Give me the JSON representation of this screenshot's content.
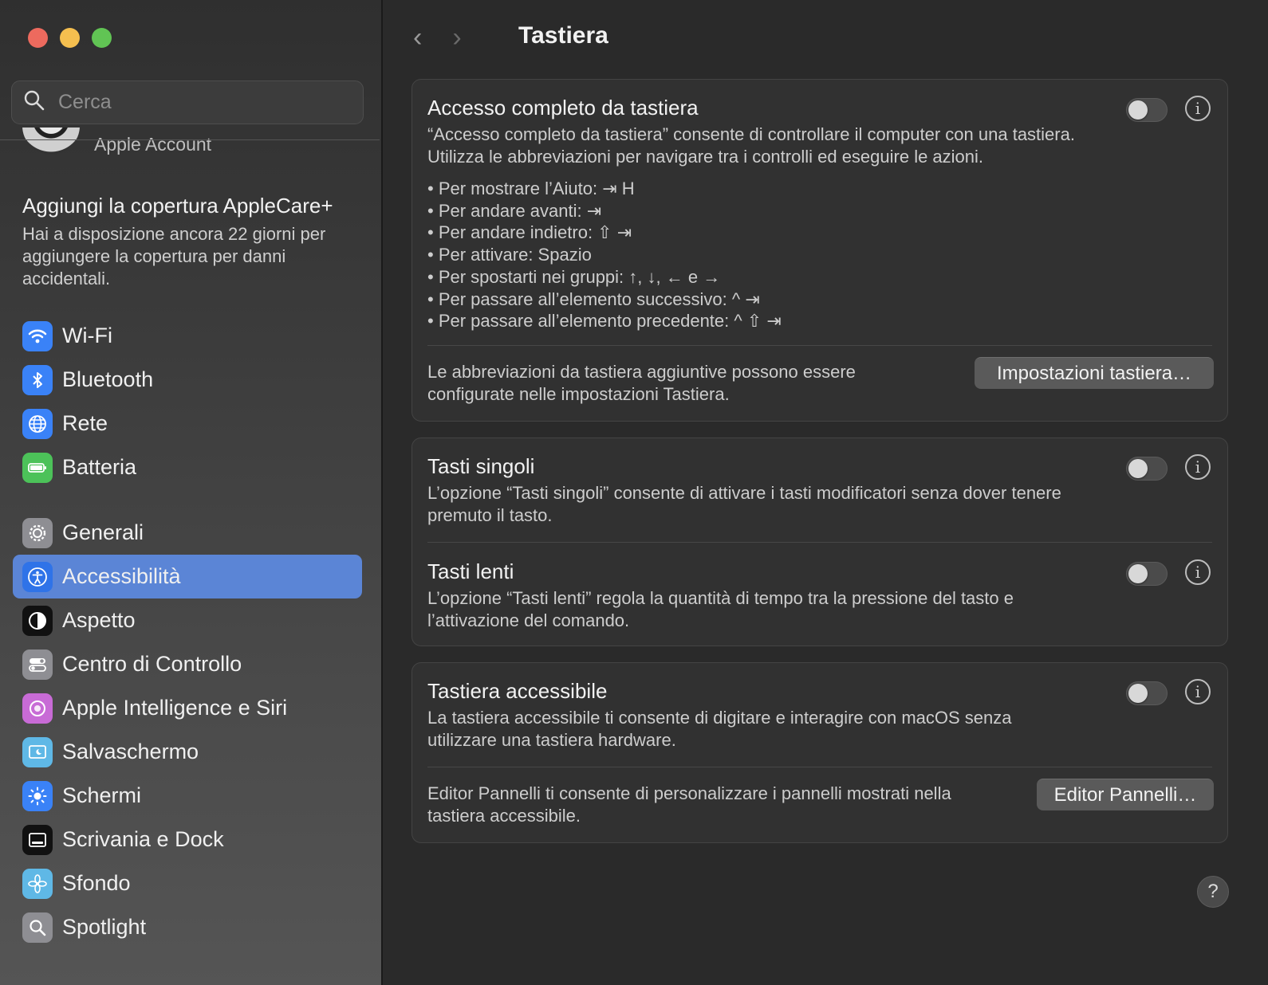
{
  "sidebar": {
    "search": {
      "placeholder": "Cerca"
    },
    "account": {
      "label": "Apple Account"
    },
    "applecare": {
      "title": "Aggiungi la copertura AppleCare+",
      "text": "Hai a disposizione ancora 22 giorni per aggiungere la copertura per danni accidentali."
    },
    "group1": [
      {
        "label": "Wi-Fi",
        "icon": "wifi-icon",
        "color": "#3a82f7"
      },
      {
        "label": "Bluetooth",
        "icon": "bluetooth-icon",
        "color": "#3a82f7"
      },
      {
        "label": "Rete",
        "icon": "globe-icon",
        "color": "#3a82f7"
      },
      {
        "label": "Batteria",
        "icon": "battery-icon",
        "color": "#4cc259"
      }
    ],
    "group2": [
      {
        "label": "Generali",
        "icon": "gear-icon",
        "color": "#8e8e93"
      },
      {
        "label": "Accessibilità",
        "icon": "accessibility-icon",
        "color": "#2f73e8"
      },
      {
        "label": "Aspetto",
        "icon": "appearance-icon",
        "color": "#111111"
      },
      {
        "label": "Centro di Controllo",
        "icon": "control-center-icon",
        "color": "#8e8e93"
      },
      {
        "label": "Apple Intelligence e Siri",
        "icon": "siri-icon",
        "color": "#c86bd6"
      },
      {
        "label": "Salvaschermo",
        "icon": "screensaver-icon",
        "color": "#5fb8e6"
      },
      {
        "label": "Schermi",
        "icon": "sun-icon",
        "color": "#3a82f7"
      },
      {
        "label": "Scrivania e Dock",
        "icon": "dock-icon",
        "color": "#111111"
      },
      {
        "label": "Sfondo",
        "icon": "flower-icon",
        "color": "#5fb8e6"
      },
      {
        "label": "Spotlight",
        "icon": "magnifier-icon",
        "color": "#8e8e93"
      }
    ],
    "active_label": "Accessibilità"
  },
  "main": {
    "title": "Tastiera",
    "full_keyboard": {
      "title": "Accesso completo da tastiera",
      "desc": "“Accesso completo da tastiera” consente di controllare il computer con una tastiera. Utilizza le abbreviazioni per navigare tra i controlli ed eseguire le azioni.",
      "bullets": [
        "Per mostrare l’Aiuto: ⇥ H",
        "Per andare avanti: ⇥",
        "Per andare indietro: ⇧ ⇥",
        "Per attivare: Spazio",
        "Per spostarti nei gruppi: ↑, ↓, ← e →",
        "Per passare all’elemento successivo: ^ ⇥",
        "Per passare all’elemento precedente: ^ ⇧ ⇥"
      ],
      "footer_text": "Le abbreviazioni da tastiera aggiuntive possono essere configurate nelle impostazioni Tastiera.",
      "button": "Impostazioni tastiera…",
      "enabled": false
    },
    "sticky_keys": {
      "title": "Tasti singoli",
      "desc": "L’opzione “Tasti singoli” consente di attivare i tasti modificatori senza dover tenere premuto il tasto.",
      "enabled": false
    },
    "slow_keys": {
      "title": "Tasti lenti",
      "desc": "L’opzione “Tasti lenti” regola la quantità di tempo tra la pressione del tasto e l’attivazione del comando.",
      "enabled": false
    },
    "accessible_keyboard": {
      "title": "Tastiera accessibile",
      "desc": "La tastiera accessibile ti consente di digitare e interagire con macOS senza utilizzare una tastiera hardware.",
      "footer_text": "Editor Pannelli ti consente di personalizzare i pannelli mostrati nella tastiera accessibile.",
      "button": "Editor Pannelli…",
      "enabled": false
    },
    "info_glyph": "i",
    "help_glyph": "?"
  }
}
